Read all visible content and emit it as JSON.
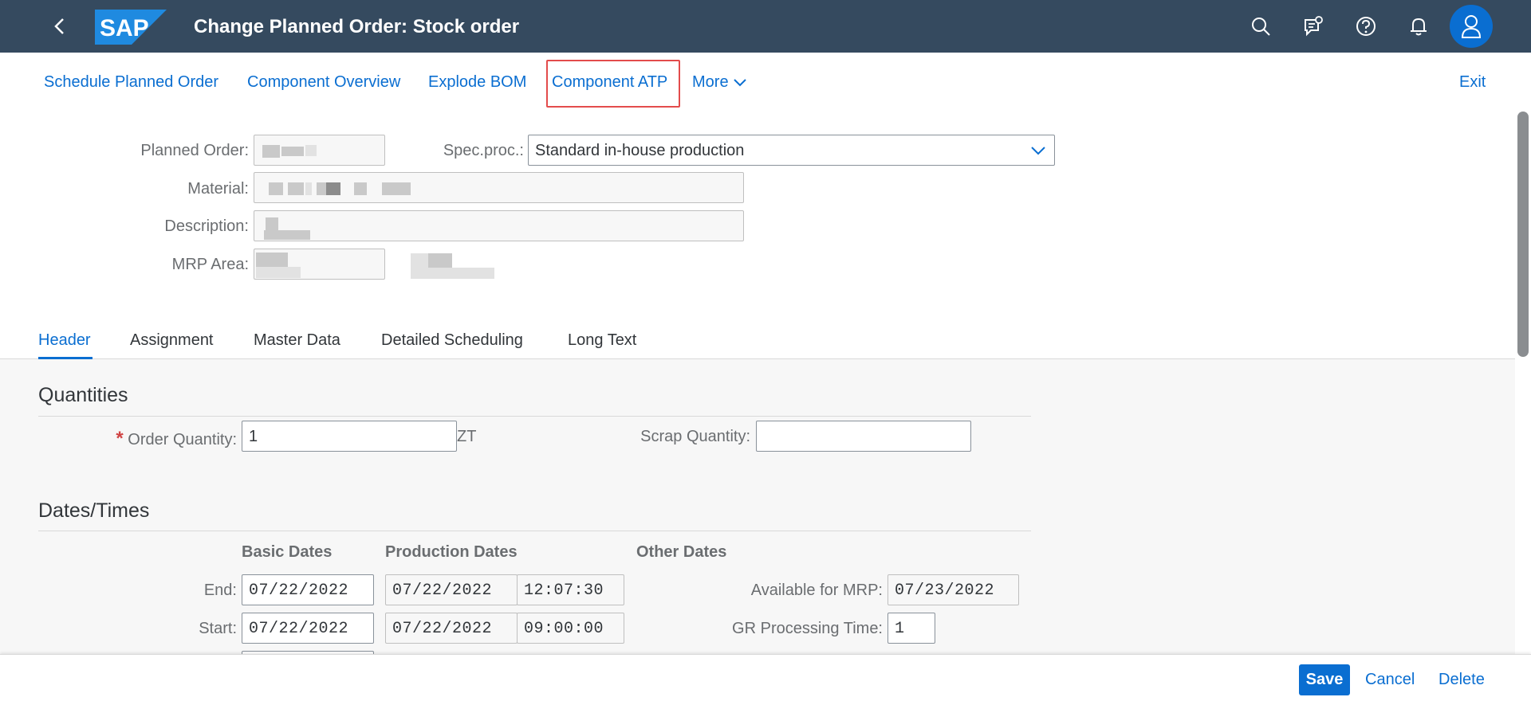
{
  "shell": {
    "title": "Change Planned Order: Stock order",
    "logo_text": "SAP",
    "icons": [
      "back-icon",
      "search-icon",
      "feedback-icon",
      "help-icon",
      "notification-icon",
      "user-avatar-icon"
    ]
  },
  "toolbar": {
    "schedule": "Schedule Planned Order",
    "component_overview": "Component Overview",
    "explode_bom": "Explode BOM",
    "component_atp": "Component ATP",
    "more": "More",
    "exit": "Exit"
  },
  "header_form": {
    "planned_order_label": "Planned Order:",
    "planned_order_value": "",
    "spec_proc_label": "Spec.proc.:",
    "spec_proc_value": "Standard in-house production",
    "material_label": "Material:",
    "description_label": "Description:",
    "mrp_area_label": "MRP Area:"
  },
  "tabs": [
    "Header",
    "Assignment",
    "Master Data",
    "Detailed Scheduling",
    "Long Text"
  ],
  "quantities": {
    "title": "Quantities",
    "required_mark": "*",
    "order_qty_label": "Order Quantity:",
    "order_qty_value": "1",
    "unit": "ZT",
    "scrap_qty_label": "Scrap Quantity:",
    "scrap_qty_value": ""
  },
  "dates": {
    "title": "Dates/Times",
    "col_basic": "Basic Dates",
    "col_production": "Production Dates",
    "col_other": "Other Dates",
    "end_label": "End:",
    "end_basic": "07/22/2022",
    "end_prod_date": "07/22/2022",
    "end_prod_time": "12:07:30",
    "start_label": "Start:",
    "start_basic": "07/22/2022",
    "start_prod_date": "07/22/2022",
    "start_prod_time": "09:00:00",
    "avail_mrp_label": "Available for MRP:",
    "avail_mrp_value": "07/23/2022",
    "gr_time_label": "GR Processing Time:",
    "gr_time_value": "1"
  },
  "footer": {
    "save": "Save",
    "cancel": "Cancel",
    "delete": "Delete"
  },
  "colors": {
    "shell_bg": "#354a5f",
    "accent": "#0a6ed1",
    "highlight": "#e34c4c"
  }
}
